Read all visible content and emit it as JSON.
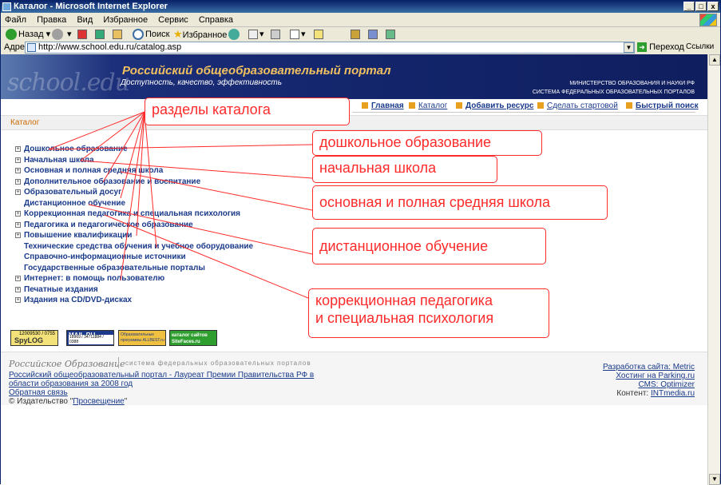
{
  "window": {
    "title": "Каталог - Microsoft Internet Explorer",
    "min_label": "_",
    "max_label": "□",
    "close_label": "x"
  },
  "menubar": [
    "Файл",
    "Правка",
    "Вид",
    "Избранное",
    "Сервис",
    "Справка"
  ],
  "toolbar": {
    "back": "Назад",
    "search": "Поиск",
    "favorites": "Избранное"
  },
  "address": {
    "label": "Адрес:",
    "url": "http://www.school.edu.ru/catalog.asp",
    "go": "Переход",
    "links": "Ссылки"
  },
  "banner": {
    "watermark": "school.edu",
    "title": "Российский общеобразовательный портал",
    "slogan": "Доступность, качество, эффективность",
    "ministry": "МИНИСТЕРСТВО ОБРАЗОВАНИЯ И НАУКИ РФ",
    "system": "СИСТЕМА ФЕДЕРАЛЬНЫХ ОБРАЗОВАТЕЛЬНЫХ ПОРТАЛОВ"
  },
  "nav": {
    "home": "Главная",
    "catalog": "Каталог",
    "add_resource": "Добавить ресурс",
    "make_start": "Сделать стартовой",
    "quick_search": "Быстрый поиск"
  },
  "breadcrumb": "Каталог",
  "catalog": [
    {
      "label": "Дошкольное образование",
      "expandable": true
    },
    {
      "label": "Начальная школа",
      "expandable": true
    },
    {
      "label": "Основная и полная средняя школа",
      "expandable": true
    },
    {
      "label": "Дополнительное образование и воспитание",
      "expandable": true
    },
    {
      "label": "Образовательный досуг",
      "expandable": true
    },
    {
      "label": "Дистанционное обучение",
      "expandable": false
    },
    {
      "label": "Коррекционная педагогика и специальная психология",
      "expandable": true
    },
    {
      "label": "Педагогика и педагогическое образование",
      "expandable": true
    },
    {
      "label": "Повышение квалификации",
      "expandable": true
    },
    {
      "label": "Технические средства обучения и учебное оборудование",
      "expandable": false
    },
    {
      "label": "Справочно-информационные источники",
      "expandable": false
    },
    {
      "label": "Государственные образовательные порталы",
      "expandable": false
    },
    {
      "label": "Интернет: в помощь пользователю",
      "expandable": true
    },
    {
      "label": "Печатные издания",
      "expandable": true
    },
    {
      "label": "Издания на CD/DVD-дисках",
      "expandable": true
    }
  ],
  "badges": {
    "spylog_nums": "12009530 / 0755",
    "spylog": "SpyLOG",
    "mailru": "MAIL.RU",
    "mailru_nums": "18969 / 34711884 / 0388",
    "allbest": "Образовательные программы ALLBEST.ru",
    "sitefaces": "каталог сайтов SiteFaces.ru"
  },
  "footer": {
    "logo": "Российское Образование",
    "logo_sub": "система федеральных образовательных порталов",
    "laureate": "Российский общеобразовательный портал - Лауреат Премии Правительства РФ в области образования за 2008 год",
    "feedback": "Обратная связь",
    "copyright_prefix": "© Издательство \"",
    "publisher": "Просвещение",
    "copyright_suffix": "\"",
    "dev": "Разработка сайта: Metric",
    "hosting": "Хостинг на Parking.ru",
    "cms": "CMS: Optimizer",
    "content_prefix": "Контент: ",
    "content_link": "INTmedia.ru"
  },
  "annotations": {
    "sections": "разделы каталога",
    "preschool": "дошкольное образование",
    "primary": "начальная школа",
    "secondary": "основная и полная средняя школа",
    "distance": "дистанционное обучение",
    "correction_line1": "коррекционная педагогика",
    "correction_line2": "и специальная психология"
  },
  "colors": {
    "annotation": "#ff2a2a",
    "link": "#1a3a8a",
    "banner": "#14266d",
    "banner_title": "#f0c060",
    "breadcrumb": "#d06a00"
  }
}
